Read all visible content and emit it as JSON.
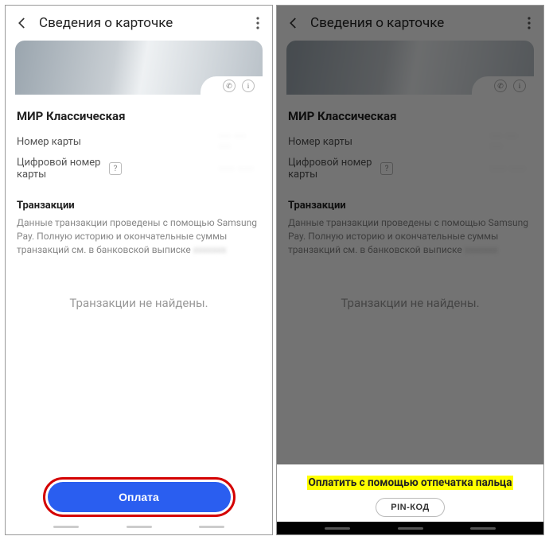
{
  "screen1": {
    "header": {
      "title": "Сведения о карточке"
    },
    "card": {
      "name": "МИР Классическая"
    },
    "cardNumber": {
      "label": "Номер карты",
      "value": "··· ··· ···"
    },
    "digitalNumber": {
      "label": "Цифровой номер карты",
      "help": "?",
      "value": "···· ····"
    },
    "transactions": {
      "label": "Транзакции",
      "desc_pre": "Данные транзакции проведены с помощью Samsung Pay. Полную историю и окончательные суммы транзакций см. в банковской выписке",
      "empty": "Транзакции не найдены."
    },
    "payButton": "Оплата"
  },
  "screen2": {
    "header": {
      "title": "Сведения о карточке"
    },
    "card": {
      "name": "МИР Классическая"
    },
    "cardNumber": {
      "label": "Номер карты",
      "value": "··· ··· ···"
    },
    "digitalNumber": {
      "label": "Цифровой номер карты",
      "help": "?",
      "value": "···· ····"
    },
    "transactions": {
      "label": "Транзакции",
      "desc_pre": "Данные транзакции проведены с помощью Samsung Pay. Полную историю и окончательные суммы транзакций см. в банковской выписке",
      "empty": "Транзакции не найдены."
    },
    "sheet": {
      "fingerprint": "Оплатить с помощью отпечатка пальца",
      "pin": "PIN-КОД"
    }
  }
}
